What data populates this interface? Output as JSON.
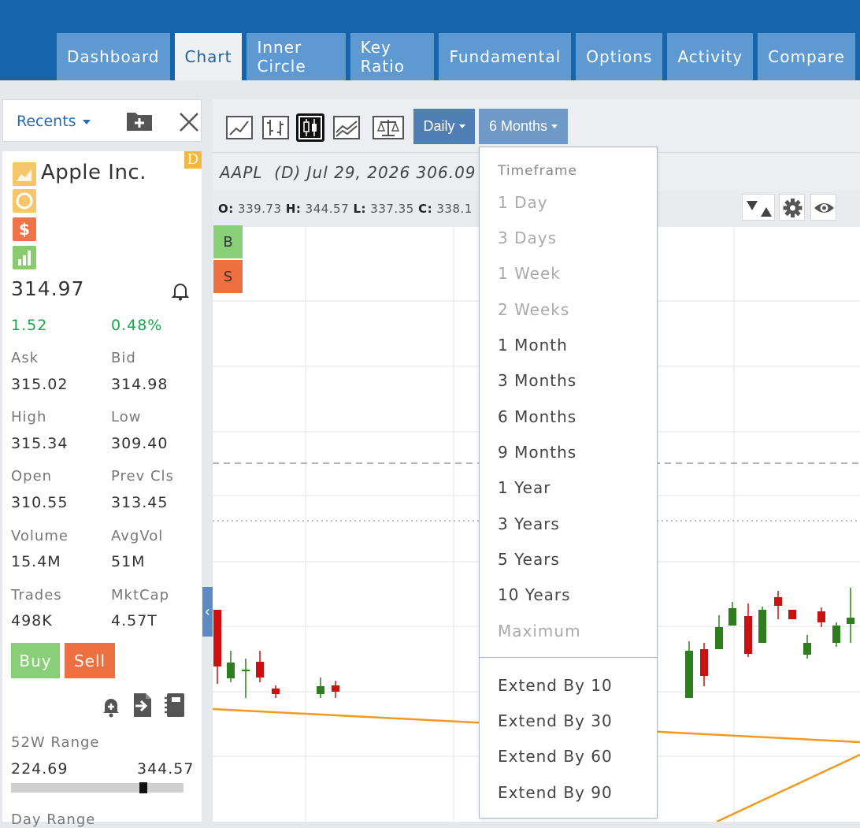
{
  "tabs": [
    "Dashboard",
    "Chart",
    "Inner Circle",
    "Key Ratio",
    "Fundamental",
    "Options",
    "Activity",
    "Compare"
  ],
  "left": {
    "recents_label": "Recents",
    "badge": "D",
    "company": "Apple Inc.",
    "price": "314.97",
    "change": "1.52",
    "change_pct": "0.48%",
    "ask_label": "Ask",
    "ask": "315.02",
    "bid_label": "Bid",
    "bid": "314.98",
    "high_label": "High",
    "high": "315.34",
    "low_label": "Low",
    "low": "309.40",
    "open_label": "Open",
    "open": "310.55",
    "prev_label": "Prev Cls",
    "prev": "313.45",
    "volume_label": "Volume",
    "volume": "15.4M",
    "avgvol_label": "AvgVol",
    "avgvol": "51M",
    "trades_label": "Trades",
    "trades": "498K",
    "mktcap_label": "MktCap",
    "mktcap": "4.57T",
    "buy_label": "Buy",
    "sell_label": "Sell",
    "range52_label": "52W Range",
    "range52_low": "224.69",
    "range52_high": "344.57",
    "range52_position": 0.78,
    "dayrange_label": "Day Range"
  },
  "chart": {
    "interval_label": "Daily",
    "period_label": "6 Months",
    "symbol_line": "AAPL  (D) Jul 29, 2026 306.09",
    "o_label": "O:",
    "o": "339.73",
    "h_label": "H:",
    "h": "344.57",
    "l_label": "L:",
    "l": "337.35",
    "c_label": "C:",
    "c": "338.1",
    "b_label": "B",
    "s_label": "S"
  },
  "menu": {
    "header": "Timeframe",
    "items": [
      {
        "label": "1 Day",
        "disabled": true
      },
      {
        "label": "3 Days",
        "disabled": true
      },
      {
        "label": "1 Week",
        "disabled": true
      },
      {
        "label": "2 Weeks",
        "disabled": true
      },
      {
        "label": "1 Month",
        "disabled": false
      },
      {
        "label": "3 Months",
        "disabled": false
      },
      {
        "label": "6 Months",
        "disabled": false
      },
      {
        "label": "9 Months",
        "disabled": false
      },
      {
        "label": "1 Year",
        "disabled": false
      },
      {
        "label": "3 Years",
        "disabled": false
      },
      {
        "label": "5 Years",
        "disabled": false
      },
      {
        "label": "10 Years",
        "disabled": false
      },
      {
        "label": "Maximum",
        "disabled": true
      }
    ],
    "extend": [
      "Extend By 10",
      "Extend By 30",
      "Extend By 60",
      "Extend By 90"
    ]
  },
  "colors": {
    "topbar": "#1565ad",
    "tab": "#5f99d1",
    "up": "#2e7d1f",
    "down": "#cc1010",
    "trend": "#f39a1e",
    "buy": "#88cf78",
    "sell": "#ec7040"
  }
}
